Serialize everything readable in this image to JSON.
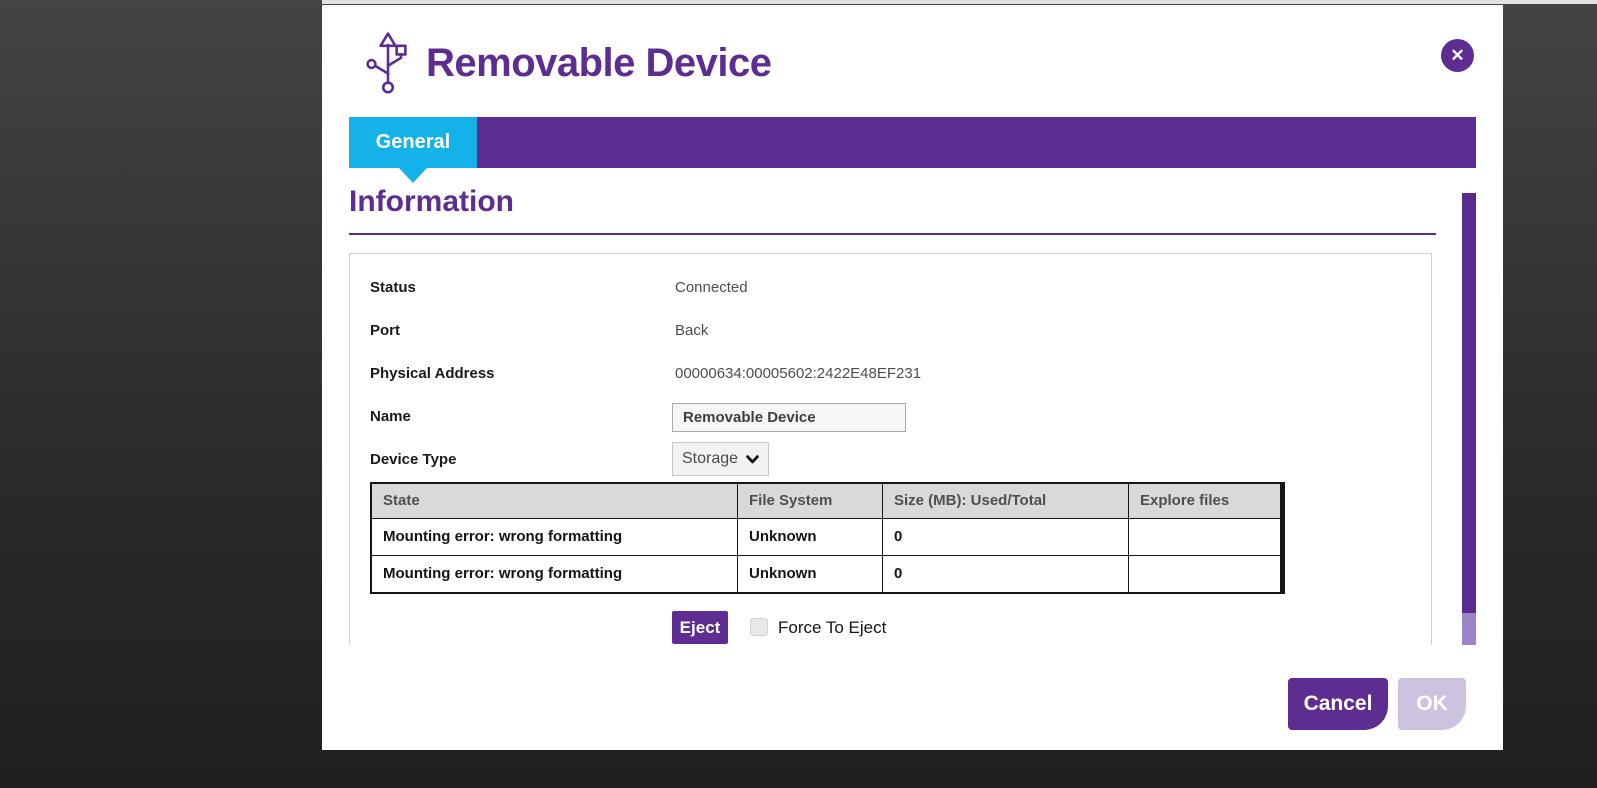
{
  "modal": {
    "title": "Removable Device"
  },
  "icons": {
    "close": "✕",
    "usb": "usb-icon",
    "chevron_down": "chevron-down-icon"
  },
  "tabs": [
    {
      "label": "General",
      "active": true
    }
  ],
  "section": {
    "heading": "Information"
  },
  "fields": [
    {
      "label": "Status",
      "value": "Connected",
      "type": "text"
    },
    {
      "label": "Port",
      "value": "Back",
      "type": "text"
    },
    {
      "label": "Physical Address",
      "value": "00000634:00005602:2422E48EF231",
      "type": "text"
    },
    {
      "label": "Name",
      "value": "Removable Device",
      "type": "input"
    },
    {
      "label": "Device Type",
      "value": "Storage",
      "type": "select"
    }
  ],
  "table": {
    "columns": [
      "State",
      "File System",
      "Size (MB): Used/Total",
      "Explore files"
    ],
    "rows": [
      [
        "Mounting error: wrong formatting",
        "Unknown",
        "0",
        ""
      ],
      [
        "Mounting error: wrong formatting",
        "Unknown",
        "0",
        ""
      ]
    ]
  },
  "eject": {
    "button_label": "Eject",
    "checkbox_label": "Force To Eject",
    "checked": false
  },
  "footer": {
    "cancel_label": "Cancel",
    "ok_label": "OK"
  },
  "colors": {
    "brand_purple": "#5e2d91",
    "tab_bar_purple": "#5b2d92",
    "active_tab_cyan": "#14b2e8",
    "ok_disabled": "#cdc3e0",
    "table_header_bg": "#d9d9d9",
    "scroll_thumb": "#5a2b8f",
    "scroll_track": "#9c85c6",
    "background_dark": "#2a2a2a"
  }
}
